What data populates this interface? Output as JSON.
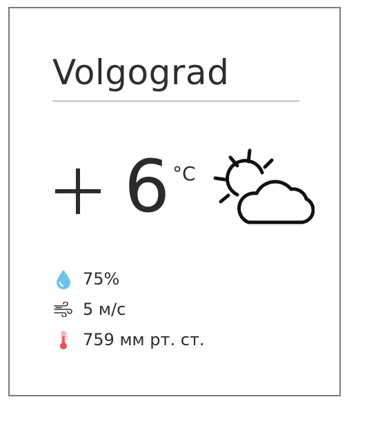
{
  "weather": {
    "city": "Volgograd",
    "temperature_sign": "+",
    "temperature_value": "6",
    "temperature_unit": "°C",
    "condition_icon": "partly-cloudy-sun-icon",
    "humidity": "75%",
    "wind": "5 м/с",
    "pressure": "759 мм рт. ст."
  },
  "icons": {
    "humidity": "water-drop-icon",
    "wind": "wind-icon",
    "pressure": "thermometer-icon"
  },
  "colors": {
    "border": "#7a7a7a",
    "divider": "#d0d0d0",
    "text": "#2b2b2b",
    "drop": "#6fc3e8",
    "thermometer": "#e8505b"
  }
}
